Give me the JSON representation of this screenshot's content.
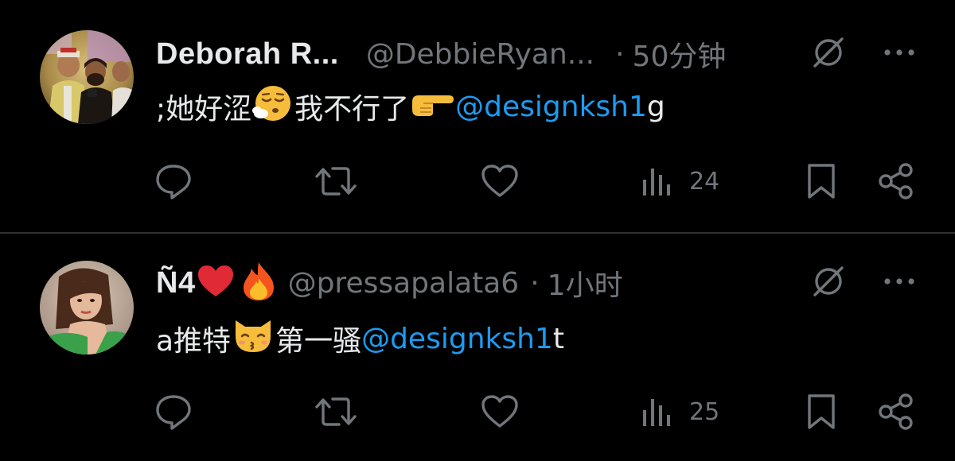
{
  "tweets": [
    {
      "display_name": "Deborah R...",
      "handle": "@DebbieRyan...",
      "separator": "·",
      "time": "50分钟",
      "text_before": ";她好涩",
      "emoji_1": "relieved-face-with-exhale",
      "text_middle": "我不行了",
      "emoji_2": "backhand-index-pointing-right",
      "mention": "@designksh1",
      "text_after": " g",
      "views": "24",
      "avatar": "group-photo-avatar"
    },
    {
      "display_name_prefix": "Ñ4",
      "name_emoji_1": "red-heart",
      "name_emoji_2": "fire",
      "handle": "@pressapalata6",
      "separator": "·",
      "time": "1小时",
      "text_before": "a推特",
      "emoji_1": "kissing-cat-face",
      "text_middle": "第一骚",
      "mention": "@designksh1",
      "text_after": " t",
      "views": "25",
      "avatar": "woman-portrait-avatar"
    }
  ],
  "colors": {
    "background": "#000000",
    "text": "#e7e9ea",
    "muted": "#71767b",
    "link": "#1d9bf0",
    "divider": "#2f3336"
  },
  "icons": [
    "reply-icon",
    "retweet-icon",
    "like-icon",
    "views-icon",
    "bookmark-icon",
    "share-icon",
    "grok-icon",
    "more-icon"
  ]
}
